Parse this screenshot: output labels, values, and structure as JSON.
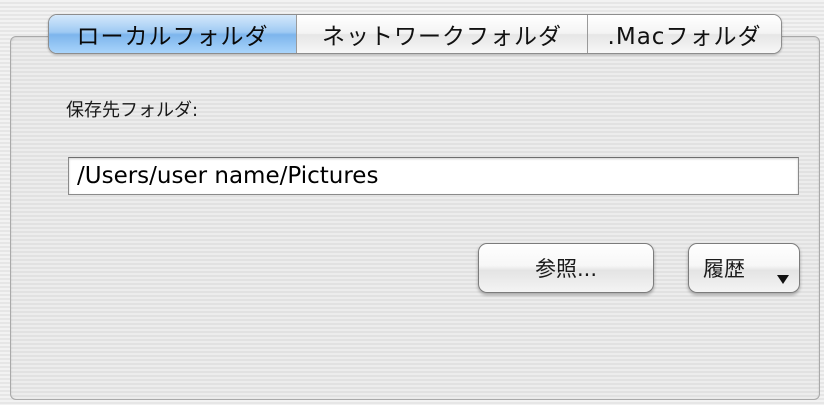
{
  "tabs": [
    {
      "label": "ローカルフォルダ",
      "selected": true
    },
    {
      "label": "ネットワークフォルダ",
      "selected": false
    },
    {
      "label": ".Macフォルダ",
      "selected": false
    }
  ],
  "destination": {
    "label": "保存先フォルダ:",
    "path_value": "/Users/user name/Pictures"
  },
  "buttons": {
    "browse_label": "参照...",
    "history_label": "履歴"
  },
  "icons": {
    "history_dropdown": "triangle-down-icon"
  },
  "colors": {
    "selected_tab": "#8cc0f0"
  }
}
